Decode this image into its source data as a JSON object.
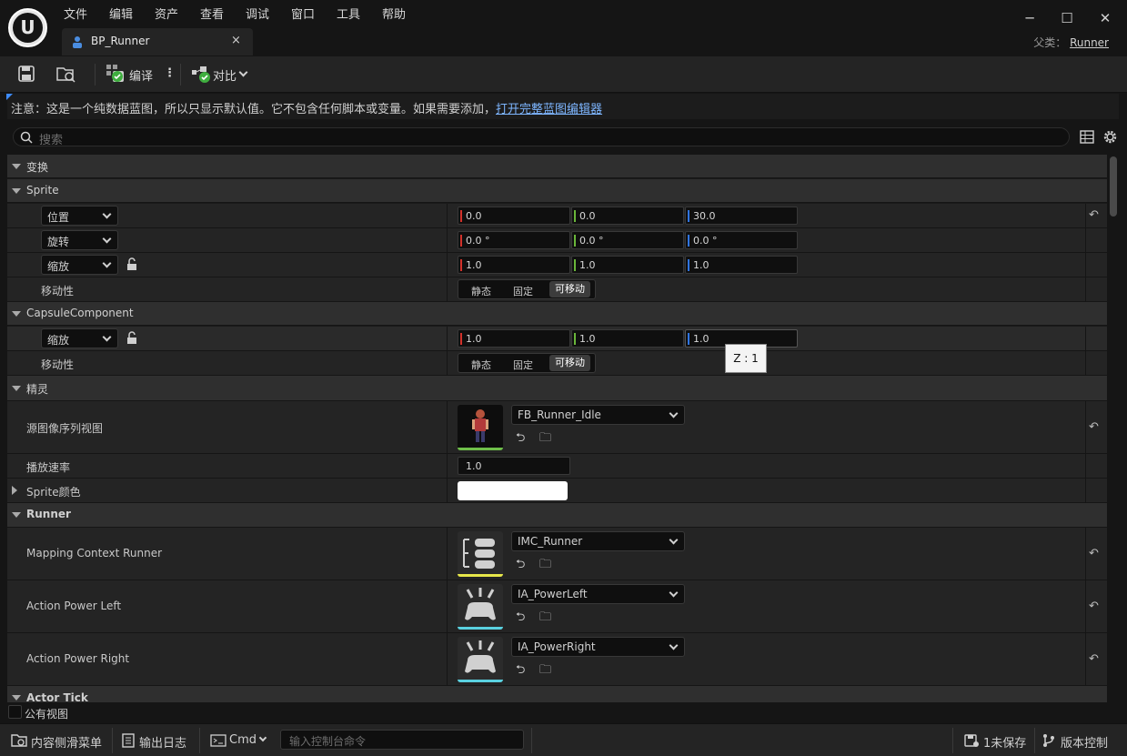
{
  "menu": [
    "文件",
    "编辑",
    "资产",
    "查看",
    "调试",
    "窗口",
    "工具",
    "帮助"
  ],
  "tab": {
    "label": "BP_Runner",
    "close": "×"
  },
  "window": {
    "minimize": "─",
    "maximize": "☐",
    "close": "✕"
  },
  "parent": {
    "prefix": "父类：",
    "name": "Runner"
  },
  "toolbar": {
    "compile": "编译",
    "more": "⋮",
    "diff": "对比"
  },
  "notice": {
    "text": "注意：这是一个纯数据蓝图，所以只显示默认值。它不包含任何脚本或变量。如果需要添加，",
    "link": "打开完整蓝图编辑器"
  },
  "search": {
    "placeholder": "搜索"
  },
  "categories": {
    "transform": "变换",
    "sprite": "Sprite",
    "capsule": "CapsuleComponent",
    "jingling": "精灵",
    "runner": "Runner",
    "actor_tick": "Actor Tick"
  },
  "sprite_rows": {
    "location": {
      "label": "位置",
      "x": "0.0",
      "y": "0.0",
      "z": "30.0"
    },
    "rotation": {
      "label": "旋转",
      "x": "0.0 °",
      "y": "0.0 °",
      "z": "0.0 °"
    },
    "scale": {
      "label": "缩放",
      "x": "1.0",
      "y": "1.0",
      "z": "1.0"
    },
    "mobility": {
      "label": "移动性",
      "options": [
        "静态",
        "固定",
        "可移动"
      ],
      "selected": "可移动"
    }
  },
  "capsule_rows": {
    "scale": {
      "label": "缩放",
      "x": "1.0",
      "y": "1.0",
      "z": "1.0"
    },
    "mobility": {
      "label": "移动性",
      "options": [
        "静态",
        "固定",
        "可移动"
      ],
      "selected": "可移动"
    }
  },
  "tooltip": "Z : 1",
  "jingling_rows": {
    "source": {
      "label": "源图像序列视图",
      "value": "FB_Runner_Idle"
    },
    "rate": {
      "label": "播放速率",
      "value": "1.0"
    },
    "color": {
      "label": "Sprite颜色",
      "value": "#ffffff"
    }
  },
  "runner_rows": [
    {
      "label": "Mapping Context Runner",
      "value": "IMC_Runner",
      "accent": "#e8e84a"
    },
    {
      "label": "Action Power Left",
      "value": "IA_PowerLeft",
      "accent": "#5ad1e0"
    },
    {
      "label": "Action Power Right",
      "value": "IA_PowerRight",
      "accent": "#5ad1e0"
    }
  ],
  "public_view": "公有视图",
  "statusbar": {
    "content_drawer": "内容侧滑菜单",
    "output_log": "输出日志",
    "cmd": "Cmd",
    "console_placeholder": "输入控制台命令",
    "unsaved": "1未保存",
    "source_control": "版本控制"
  },
  "colors": {
    "x_axis": "#d2312a",
    "y_axis": "#6ab63a",
    "z_axis": "#2f74e0",
    "link": "#7eb6ff"
  }
}
